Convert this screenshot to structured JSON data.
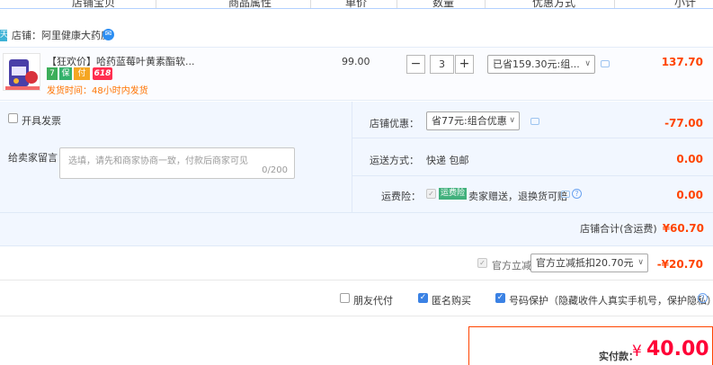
{
  "header": {
    "columns": [
      "店铺宝贝",
      "商品属性",
      "单价",
      "数量",
      "优惠方式",
      "小计"
    ]
  },
  "shop": {
    "tag": "天猫",
    "name": "店铺：阿里健康大药房"
  },
  "item": {
    "title": "【狂欢价】哈药蓝莓叶黄素酯软...",
    "badges": [
      "7",
      "保",
      "付",
      "618"
    ],
    "ship_time": "发货时间：48小时内发货",
    "price": "99.00",
    "qty": "3",
    "minus": "−",
    "plus": "+",
    "discount_select": "已省159.30元:组...",
    "subtotal": "137.70"
  },
  "options": {
    "invoice_label": "开具发票",
    "message_label": "给卖家留言：",
    "message_placeholder": "选填，请先和商家协商一致，付款后商家可见",
    "message_count": "0/200",
    "store_discount_label": "店铺优惠：",
    "store_discount_select": "省77元:组合优惠",
    "store_discount_amount": "-77.00",
    "shipping_label": "运送方式：",
    "shipping_value": "快递 包邮",
    "shipping_amount": "0.00",
    "insurance_label": "运费险：",
    "insurance_tag": "运费险",
    "insurance_text": "卖家赠送，退换货可赔",
    "insurance_amount": "0.00",
    "store_total_label": "店铺合计(含运费)",
    "store_total": "¥60.70"
  },
  "official": {
    "label": "官方立减",
    "select": "官方立减抵扣20.70元",
    "amount": "-¥20.70"
  },
  "bottom": {
    "friend_pay": "朋友代付",
    "anonymous": "匿名购买",
    "number_protect": "号码保护（隐藏收件人真实手机号，保护隐私）"
  },
  "pay": {
    "label": "实付款：",
    "currency": "¥",
    "amount": "40.00"
  },
  "colors": {
    "accent_red": "#ff4400",
    "price_red": "#ff0036",
    "link_blue": "#3b82e4",
    "panel_bg": "#f2f7ff"
  }
}
